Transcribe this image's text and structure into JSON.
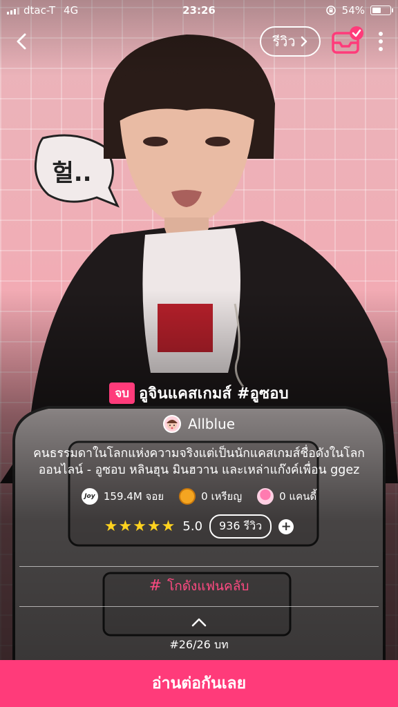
{
  "status_bar": {
    "carrier": "dtac-T",
    "network": "4G",
    "time": "23:26",
    "battery": "54%",
    "battery_level": 0.54
  },
  "nav": {
    "review_label": "รีวิว"
  },
  "artwork": {
    "speech_bubble": "헐.."
  },
  "story": {
    "status_badge": "จบ",
    "title": "อูจินแคสเกมส์ #อูซอบ",
    "author": "Allblue",
    "description": "คนธรรมดาในโลกแห่งความจริงแต่เป็นนักแคสเกมส์ชื่อดังในโลกออนไลน์ - อูซอบ หลินฮุน มินฮวาน และเหล่าแก๊งค์เพื่อน ggez",
    "stats": {
      "views": "159.4M จอย",
      "coins": "0 เหรียญ",
      "candies": "0 แคนดี้",
      "joy_icon_text": "Joy"
    },
    "rating": {
      "stars": 5,
      "stars_display": "★★★★★",
      "value": "5.0",
      "reviews": "936 รีวิว"
    },
    "fanclub_label": "โกดังแฟนคลับ",
    "episode": "#26/26 บท"
  },
  "cta_label": "อ่านต่อกันเลย",
  "colors": {
    "accent": "#ff3b7a",
    "star": "#ffd21f",
    "fanclub_text": "#ff4a82"
  },
  "icons": [
    "back-icon",
    "chevron-right-icon",
    "inbox-check-icon",
    "more-vertical-icon",
    "joy-icon",
    "coin-icon",
    "candy-icon",
    "star-icon",
    "plus-icon",
    "hash-icon",
    "chevron-up-icon"
  ]
}
